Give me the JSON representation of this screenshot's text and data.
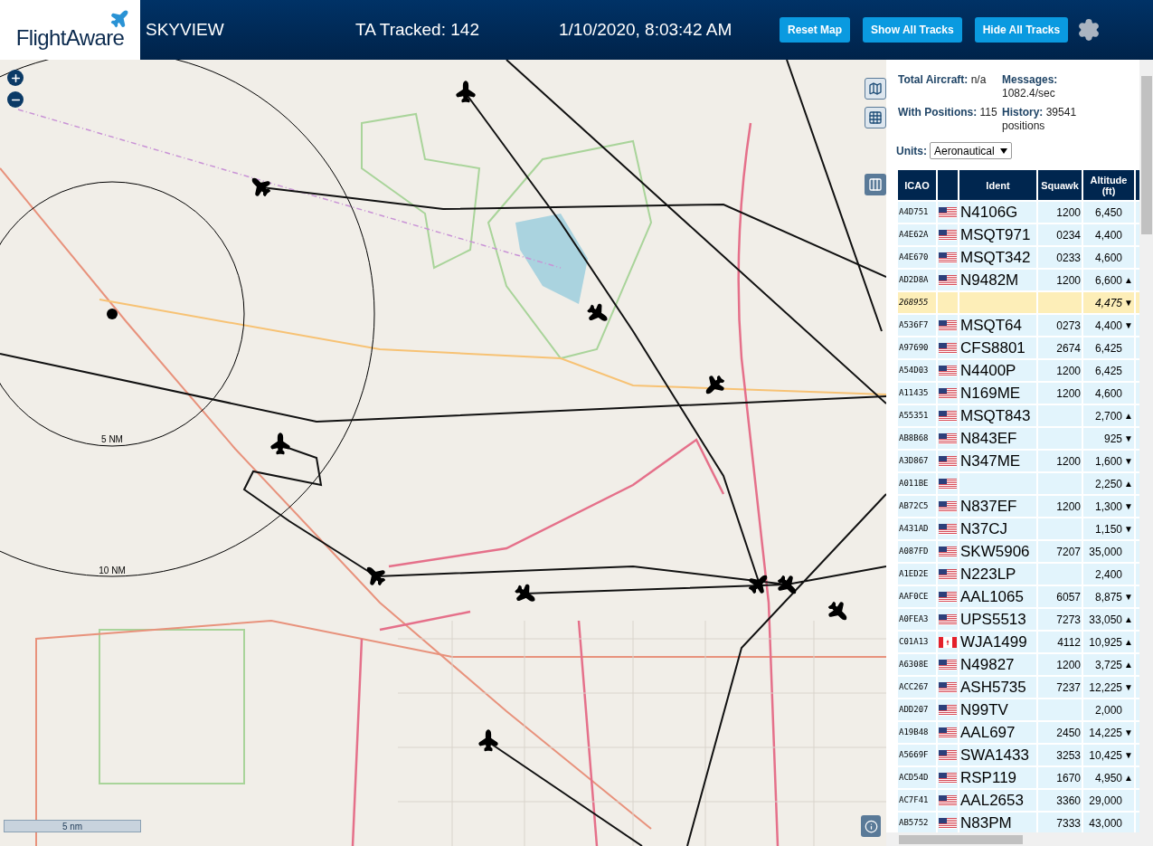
{
  "header": {
    "logo": "FlightAware",
    "title": "SKYVIEW",
    "tracked": "TA Tracked: 142",
    "datetime": "1/10/2020, 8:03:42 AM",
    "buttons": [
      "Reset Map",
      "Show All Tracks",
      "Hide All Tracks"
    ]
  },
  "map": {
    "range_labels": [
      "5 NM",
      "10 NM"
    ],
    "scale": "5 nm"
  },
  "stats": [
    {
      "label": "Total Aircraft:",
      "value": "n/a"
    },
    {
      "label": "Messages:",
      "value": "1082.4/sec"
    },
    {
      "label": "With Positions:",
      "value": "115"
    },
    {
      "label": "History:",
      "value": "39541 positions"
    }
  ],
  "units": {
    "label": "Units:",
    "value": "Aeronautical"
  },
  "table": {
    "columns": [
      "ICAO",
      "",
      "Ident",
      "Squawk",
      "Altitude (ft)"
    ],
    "rows": [
      {
        "icao": "A4D751",
        "flag": {
          "kind": "us"
        },
        "ident": "N4106G",
        "squawk": "1200",
        "altitude": "6,450",
        "trend": "",
        "selected": false
      },
      {
        "icao": "A4E62A",
        "flag": {
          "kind": "us"
        },
        "ident": "MSQT971",
        "squawk": "0234",
        "altitude": "4,400",
        "trend": "",
        "selected": false
      },
      {
        "icao": "A4E670",
        "flag": {
          "kind": "us"
        },
        "ident": "MSQT342",
        "squawk": "0233",
        "altitude": "4,600",
        "trend": "",
        "selected": false
      },
      {
        "icao": "AD2D8A",
        "flag": {
          "kind": "us"
        },
        "ident": "N9482M",
        "squawk": "1200",
        "altitude": "6,600",
        "trend": "▲",
        "selected": false
      },
      {
        "icao": "268955",
        "ident": "",
        "squawk": "",
        "altitude": "4,475",
        "trend": "▼",
        "selected": true
      },
      {
        "icao": "A536F7",
        "flag": {
          "kind": "us"
        },
        "ident": "MSQT64",
        "squawk": "0273",
        "altitude": "4,400",
        "trend": "▼",
        "selected": false
      },
      {
        "icao": "A97690",
        "flag": {
          "kind": "us"
        },
        "ident": "CFS8801",
        "squawk": "2674",
        "altitude": "6,425",
        "trend": "",
        "selected": false
      },
      {
        "icao": "A54D03",
        "flag": {
          "kind": "us"
        },
        "ident": "N4400P",
        "squawk": "1200",
        "altitude": "6,425",
        "trend": "",
        "selected": false
      },
      {
        "icao": "A11435",
        "flag": {
          "kind": "us"
        },
        "ident": "N169ME",
        "squawk": "1200",
        "altitude": "4,600",
        "trend": "",
        "selected": false
      },
      {
        "icao": "A55351",
        "flag": {
          "kind": "us"
        },
        "ident": "MSQT843",
        "squawk": "",
        "altitude": "2,700",
        "trend": "▲",
        "selected": false
      },
      {
        "icao": "AB8B68",
        "flag": {
          "kind": "us"
        },
        "ident": "N843EF",
        "squawk": "",
        "altitude": "925",
        "trend": "▼",
        "selected": false
      },
      {
        "icao": "A3D867",
        "flag": {
          "kind": "us"
        },
        "ident": "N347ME",
        "squawk": "1200",
        "altitude": "1,600",
        "trend": "▼",
        "selected": false
      },
      {
        "icao": "A011BE",
        "flag": {
          "kind": "us"
        },
        "ident": "",
        "squawk": "",
        "altitude": "2,250",
        "trend": "▲",
        "selected": false
      },
      {
        "icao": "AB72C5",
        "flag": {
          "kind": "us"
        },
        "ident": "N837EF",
        "squawk": "1200",
        "altitude": "1,300",
        "trend": "▼",
        "selected": false
      },
      {
        "icao": "A431AD",
        "flag": {
          "kind": "us"
        },
        "ident": "N37CJ",
        "squawk": "",
        "altitude": "1,150",
        "trend": "▼",
        "selected": false
      },
      {
        "icao": "A087FD",
        "flag": {
          "kind": "us"
        },
        "ident": "SKW5906",
        "squawk": "7207",
        "altitude": "35,000",
        "trend": "",
        "selected": false
      },
      {
        "icao": "A1ED2E",
        "flag": {
          "kind": "us"
        },
        "ident": "N223LP",
        "squawk": "",
        "altitude": "2,400",
        "trend": "",
        "selected": false
      },
      {
        "icao": "AAF0CE",
        "flag": {
          "kind": "us"
        },
        "ident": "AAL1065",
        "squawk": "6057",
        "altitude": "8,875",
        "trend": "▼",
        "selected": false
      },
      {
        "icao": "A0FEA3",
        "flag": {
          "kind": "us"
        },
        "ident": "UPS5513",
        "squawk": "7273",
        "altitude": "33,050",
        "trend": "▲",
        "selected": false
      },
      {
        "icao": "C01A13",
        "flag": {
          "kind": "ca"
        },
        "ident": "WJA1499",
        "squawk": "4112",
        "altitude": "10,925",
        "trend": "▲",
        "selected": false
      },
      {
        "icao": "A6308E",
        "flag": {
          "kind": "us"
        },
        "ident": "N49827",
        "squawk": "1200",
        "altitude": "3,725",
        "trend": "▲",
        "selected": false
      },
      {
        "icao": "ACC267",
        "flag": {
          "kind": "us"
        },
        "ident": "ASH5735",
        "squawk": "7237",
        "altitude": "12,225",
        "trend": "▼",
        "selected": false
      },
      {
        "icao": "ADD207",
        "flag": {
          "kind": "us"
        },
        "ident": "N99TV",
        "squawk": "",
        "altitude": "2,000",
        "trend": "",
        "selected": false
      },
      {
        "icao": "A19B48",
        "flag": {
          "kind": "us"
        },
        "ident": "AAL697",
        "squawk": "2450",
        "altitude": "14,225",
        "trend": "▼",
        "selected": false
      },
      {
        "icao": "A5669F",
        "flag": {
          "kind": "us"
        },
        "ident": "SWA1433",
        "squawk": "3253",
        "altitude": "10,425",
        "trend": "▼",
        "selected": false
      },
      {
        "icao": "ACD54D",
        "flag": {
          "kind": "us"
        },
        "ident": "RSP119",
        "squawk": "1670",
        "altitude": "4,950",
        "trend": "▲",
        "selected": false
      },
      {
        "icao": "AC7F41",
        "flag": {
          "kind": "us"
        },
        "ident": "AAL2653",
        "squawk": "3360",
        "altitude": "29,000",
        "trend": "",
        "selected": false
      },
      {
        "icao": "AB5752",
        "flag": {
          "kind": "us"
        },
        "ident": "N83PM",
        "squawk": "7333",
        "altitude": "43,000",
        "trend": "",
        "selected": false
      }
    ]
  }
}
